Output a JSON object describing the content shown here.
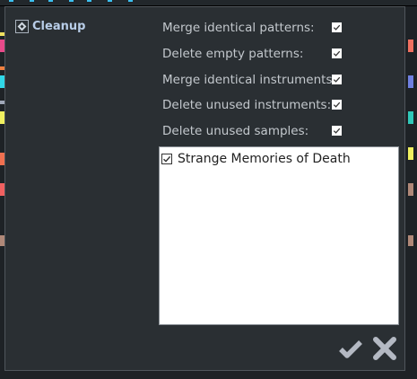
{
  "dialog": {
    "title": "Cleanup",
    "icon": "diamond-icon"
  },
  "options": [
    {
      "label": "Merge identical patterns:",
      "checked": true
    },
    {
      "label": "Delete empty patterns:",
      "checked": true
    },
    {
      "label": "Merge identical instruments:",
      "checked": true
    },
    {
      "label": "Delete unused instruments:",
      "checked": true
    },
    {
      "label": "Delete unused samples:",
      "checked": true
    }
  ],
  "songs": [
    {
      "label": "Strange Memories of Death",
      "checked": true
    }
  ],
  "buttons": {
    "confirm": "check-icon",
    "cancel": "close-icon"
  },
  "colors": {
    "dialog_bg": "#2a2f33",
    "button_icon": "#b4b9c3"
  }
}
